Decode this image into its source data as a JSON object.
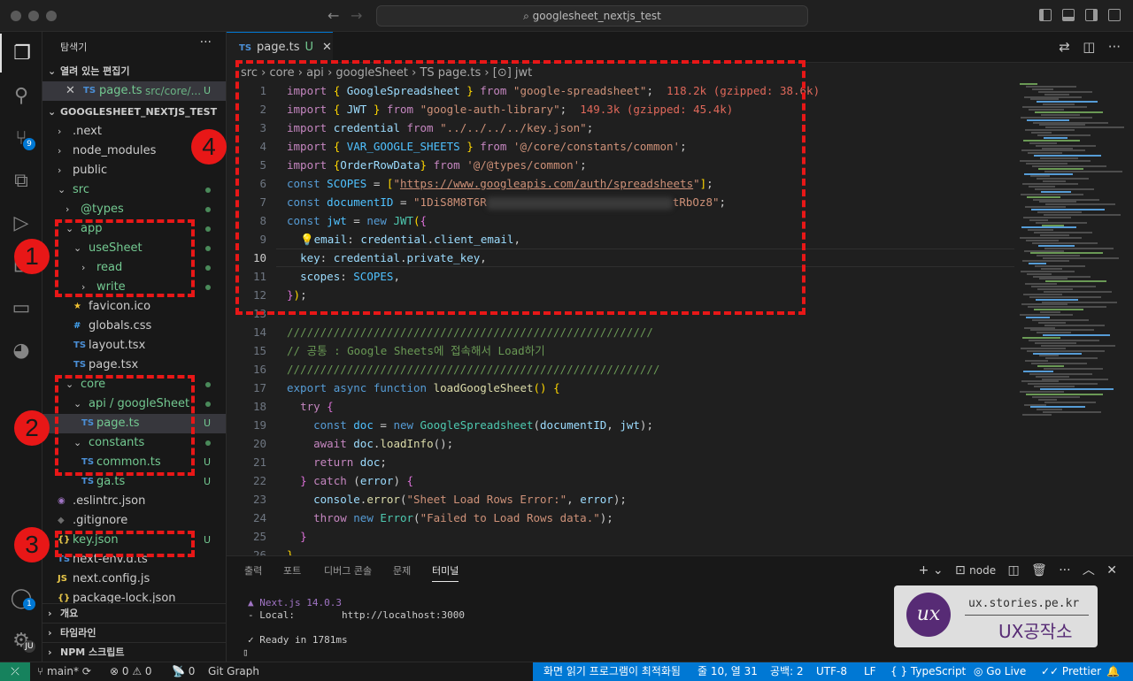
{
  "window": {
    "search_text": "googlesheet_nextjs_test"
  },
  "activity_bar": {
    "scm_badge": "9",
    "account_badge": "1",
    "manage_label": "JU"
  },
  "explorer": {
    "title": "탐색기",
    "more": "···",
    "open_editors_label": "열려 있는 편집기",
    "open_editor": {
      "name": "page.ts",
      "path": "src/core/...",
      "status": "U"
    },
    "project_label": "GOOGLESHEET_NEXTJS_TEST",
    "tree": [
      {
        "label": ".next",
        "chev": "›",
        "indent": 1
      },
      {
        "label": "node_modules",
        "chev": "›",
        "indent": 1
      },
      {
        "label": "public",
        "chev": "›",
        "indent": 1
      },
      {
        "label": "src",
        "chev": "⌄",
        "indent": 1,
        "dot": true,
        "cls": "green"
      },
      {
        "label": "@types",
        "chev": "›",
        "indent": 2,
        "dot": true,
        "cls": "green"
      },
      {
        "label": "app",
        "chev": "⌄",
        "indent": 2,
        "dot": true,
        "cls": "green"
      },
      {
        "label": "useSheet",
        "chev": "⌄",
        "indent": 3,
        "dot": true,
        "cls": "green"
      },
      {
        "label": "read",
        "chev": "›",
        "indent": 4,
        "dot": true,
        "cls": "green"
      },
      {
        "label": "write",
        "chev": "›",
        "indent": 4,
        "dot": true,
        "cls": "green"
      },
      {
        "label": "favicon.ico",
        "icon": "★",
        "iconColor": "#f1c232",
        "indent": 3
      },
      {
        "label": "globals.css",
        "icon": "#",
        "iconColor": "#42a5f5",
        "indent": 3
      },
      {
        "label": "layout.tsx",
        "icon": "TS",
        "iconColor": "#4b8fd6",
        "indent": 3
      },
      {
        "label": "page.tsx",
        "icon": "TS",
        "iconColor": "#4b8fd6",
        "indent": 3
      },
      {
        "label": "core",
        "chev": "⌄",
        "indent": 2,
        "dot": true,
        "cls": "green"
      },
      {
        "label": "api / googleSheet",
        "chev": "⌄",
        "indent": 3,
        "dot": true,
        "cls": "green"
      },
      {
        "label": "page.ts",
        "icon": "TS",
        "iconColor": "#4b8fd6",
        "indent": 4,
        "status": "U",
        "cls": "green",
        "selected": true
      },
      {
        "label": "constants",
        "chev": "⌄",
        "indent": 3,
        "dot": true,
        "cls": "green"
      },
      {
        "label": "common.ts",
        "icon": "TS",
        "iconColor": "#4b8fd6",
        "indent": 4,
        "status": "U",
        "cls": "green"
      },
      {
        "label": "ga.ts",
        "icon": "TS",
        "iconColor": "#4b8fd6",
        "indent": 4,
        "status": "U",
        "cls": "green"
      },
      {
        "label": ".eslintrc.json",
        "icon": "◉",
        "iconColor": "#a074c4",
        "indent": 1
      },
      {
        "label": ".gitignore",
        "icon": "◆",
        "iconColor": "#6d6d6d",
        "indent": 1
      },
      {
        "label": "key.json",
        "icon": "{}",
        "iconColor": "#e8c74a",
        "indent": 1,
        "status": "U",
        "cls": "green"
      },
      {
        "label": "next-env.d.ts",
        "icon": "TS",
        "iconColor": "#4b8fd6",
        "indent": 1
      },
      {
        "label": "next.config.js",
        "icon": "JS",
        "iconColor": "#e8c74a",
        "indent": 1
      },
      {
        "label": "package-lock.json",
        "icon": "{}",
        "iconColor": "#e8c74a",
        "indent": 1
      }
    ],
    "outline_label": "개요",
    "timeline_label": "타임라인",
    "npm_label": "NPM 스크립트"
  },
  "editor": {
    "tab": {
      "icon": "TS",
      "name": "page.ts",
      "status": "U",
      "close": "✕"
    },
    "breadcrumb": [
      "src",
      "core",
      "api",
      "googleSheet",
      "TS page.ts",
      "[⊙] jwt"
    ],
    "current_line": 10,
    "line_count": 26
  },
  "panel": {
    "tabs": [
      "출력",
      "포트",
      "디버그 콘솔",
      "문제",
      "터미널"
    ],
    "active_tab": "터미널",
    "shell": "node",
    "terminal_lines": [
      "▲ Next.js 14.0.3",
      "- Local:        http://localhost:3000",
      "",
      "✓ Ready in 1781ms",
      "▯"
    ]
  },
  "status": {
    "branch": "main*",
    "problems": "⊗ 0 ⚠ 0",
    "ports": "📡 0",
    "git_graph": "Git Graph",
    "screen_reader": "화면 읽기 프로그램이 최적화됨",
    "position": "줄 10, 열 31",
    "spaces": "공백: 2",
    "encoding": "UTF-8",
    "eol": "LF",
    "language": "{ } TypeScript",
    "golive": "Go Live",
    "prettier": "✓✓ Prettier",
    "bell": "🔔"
  },
  "annotations": [
    "1",
    "2",
    "3",
    "4"
  ],
  "watermark": {
    "url": "ux.stories.pe.kr",
    "brand": "UX공작소",
    "logo_text": "ux"
  },
  "colors": {
    "accent": "#0078d4",
    "annotation": "#e81717",
    "git_added": "#73c991"
  }
}
